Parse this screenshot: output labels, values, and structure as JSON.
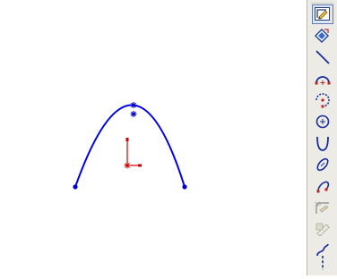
{
  "window": {
    "title": ""
  },
  "sketch": {
    "curve_color": "#0000ee",
    "origin_color": "#cc0000"
  },
  "toolbar": {
    "items": [
      {
        "icon": "edit-sketch-icon",
        "active": true
      },
      {
        "icon": "smart-dimension-icon",
        "active": false
      },
      {
        "icon": "line-icon",
        "active": false
      },
      {
        "icon": "centerpoint-arc-icon",
        "active": false
      },
      {
        "icon": "tangent-arc-icon",
        "active": false
      },
      {
        "icon": "circle-icon",
        "active": false
      },
      {
        "icon": "parabola-icon",
        "active": false
      },
      {
        "icon": "ellipse-icon",
        "active": false
      },
      {
        "icon": "partial-ellipse-icon",
        "active": false
      },
      {
        "icon": "sketch-fillet-icon",
        "active": false,
        "disabled": true
      },
      {
        "icon": "convert-entities-icon",
        "active": false,
        "disabled": true
      },
      {
        "icon": "spline-icon",
        "active": false
      },
      {
        "icon": "centerline-icon",
        "active": false
      }
    ]
  }
}
